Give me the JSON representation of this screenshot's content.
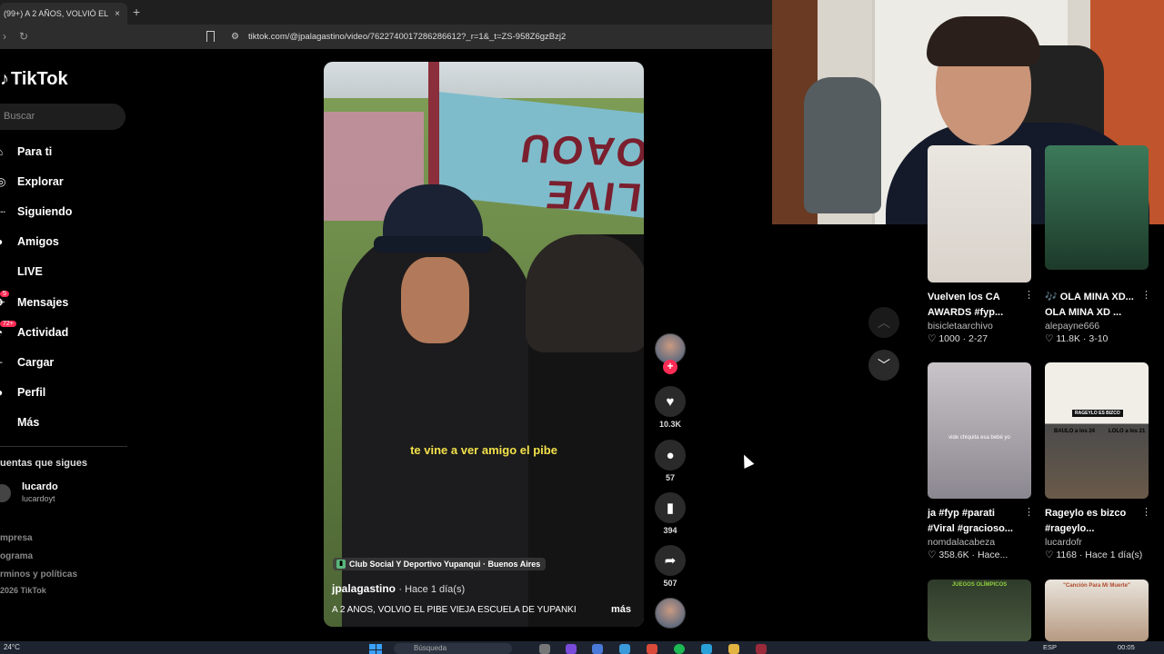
{
  "browser": {
    "tab_title": "(99+) A 2 AÑOS, VOLVIÓ EL PI",
    "tab_close": "×",
    "new_tab": "+",
    "url": "tiktok.com/@jpalagastino/video/7622740017286286612?_r=1&_t=ZS-958Z6gzBzj2"
  },
  "sidebar": {
    "logo": "TikTok",
    "search_placeholder": "Buscar",
    "items": [
      {
        "label": "Para ti",
        "icon": "home-icon"
      },
      {
        "label": "Explorar",
        "icon": "compass-icon"
      },
      {
        "label": "Siguiendo",
        "icon": "following-icon"
      },
      {
        "label": "Amigos",
        "icon": "friends-icon"
      },
      {
        "label": "LIVE",
        "icon": "live-icon"
      },
      {
        "label": "Mensajes",
        "icon": "messages-icon",
        "badge": "5"
      },
      {
        "label": "Actividad",
        "icon": "activity-icon",
        "badge": "72+"
      },
      {
        "label": "Cargar",
        "icon": "upload-icon"
      },
      {
        "label": "Perfil",
        "icon": "profile-icon"
      },
      {
        "label": "Más",
        "icon": "more-icon"
      }
    ],
    "following_header": "uentas que sigues",
    "following_account": {
      "name": "lucardo",
      "handle": "lucardoyt"
    },
    "footer": [
      "mpresa",
      "ograma",
      "rminos y políticas",
      "2026 TikTok"
    ]
  },
  "video": {
    "caption": "te vine a ver amigo el pibe",
    "location": "Club Social Y Deportivo Yupanqui · Buenos Aires",
    "author": "jpalagastino",
    "time": "· Hace 1 día(s)",
    "description": "A 2 AÑOS, VOLVIÓ EL PIBE VIEJA ESCUELA DE YUPANKI",
    "more": "más",
    "banner_text": "LIVE OAOU"
  },
  "actions": {
    "likes": "10.3K",
    "comments": "57",
    "saves": "394",
    "shares": "507"
  },
  "feed": [
    {
      "title": "Vuelven los CA AWARDS #fyp...",
      "user": "bisicletaarchivo",
      "likes": "1000",
      "date": "2-27"
    },
    {
      "title": "🎶 OLA MINA XD... OLA MINA XD ...",
      "user": "alepayne666",
      "likes": "11.8K",
      "date": "3-10"
    },
    {
      "title": "ja #fyp #parati #Viral #gracioso...",
      "user": "nomdalacabeza",
      "likes": "358.6K",
      "date": "Hace..."
    },
    {
      "title": "Rageylo es bizco #rageylo...",
      "user": "lucardofr",
      "likes": "1168",
      "date": "Hace 1 día(s)"
    }
  ],
  "thumb_texts": {
    "rageylo_banner": "RAGEYLO ES BIZCO",
    "baulo": "BAULO a los 24",
    "lolo": "LOLO a los 21",
    "twins_caption": "vide chiquita esa bebé yo",
    "bottom_left": "JUEGOS OLÍMPICOS",
    "bottom_right": "\"Canción Para Mi Muerte\""
  },
  "taskbar": {
    "weather": "24°C",
    "search": "Búsqueda",
    "lang": "ESP",
    "time": "00:05"
  },
  "colors": {
    "accent": "#fe2c55",
    "caption": "#f2e14a",
    "background": "#000000"
  }
}
